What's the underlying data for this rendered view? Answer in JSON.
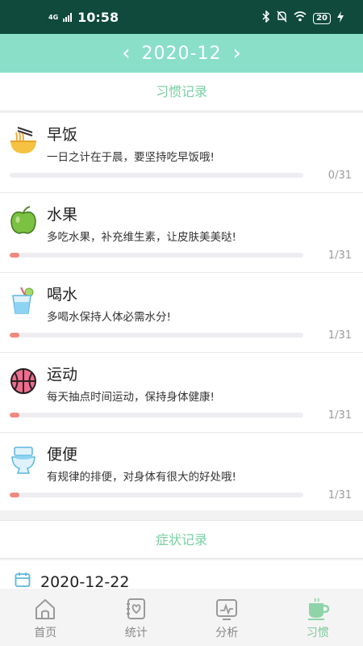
{
  "status_bar": {
    "network": "4G",
    "time": "10:58",
    "battery": "20"
  },
  "header": {
    "prev": "‹",
    "month": "2020-12",
    "next": "›"
  },
  "sections": {
    "habit_title": "习惯记录",
    "symptom_title": "症状记录"
  },
  "habits": [
    {
      "name": "早饭",
      "desc": "一日之计在于晨，要坚持吃早饭哦!",
      "count": "0/31",
      "progress": 0,
      "icon": "noodle-bowl-icon"
    },
    {
      "name": "水果",
      "desc": "多吃水果，补充维生素，让皮肤美美哒!",
      "count": "1/31",
      "progress": 0.0323,
      "icon": "apple-icon"
    },
    {
      "name": "喝水",
      "desc": "多喝水保持人体必需水分!",
      "count": "1/31",
      "progress": 0.0323,
      "icon": "water-glass-icon"
    },
    {
      "name": "运动",
      "desc": "每天抽点时间运动，保持身体健康!",
      "count": "1/31",
      "progress": 0.0323,
      "icon": "basketball-icon"
    },
    {
      "name": "便便",
      "desc": "有规律的排便，对身体有很大的好处哦!",
      "count": "1/31",
      "progress": 0.0323,
      "icon": "toilet-icon"
    }
  ],
  "symptom_record": {
    "date": "2020-12-22"
  },
  "tabs": [
    {
      "label": "首页",
      "icon": "home-icon",
      "active": false
    },
    {
      "label": "统计",
      "icon": "stats-notebook-icon",
      "active": false
    },
    {
      "label": "分析",
      "icon": "analysis-chart-icon",
      "active": false
    },
    {
      "label": "习惯",
      "icon": "cup-icon",
      "active": true
    }
  ],
  "colors": {
    "header": "#8adfc9",
    "status_bar": "#0f4a3c",
    "accent": "#7acb98",
    "progress_fill": "#ef8a80"
  }
}
